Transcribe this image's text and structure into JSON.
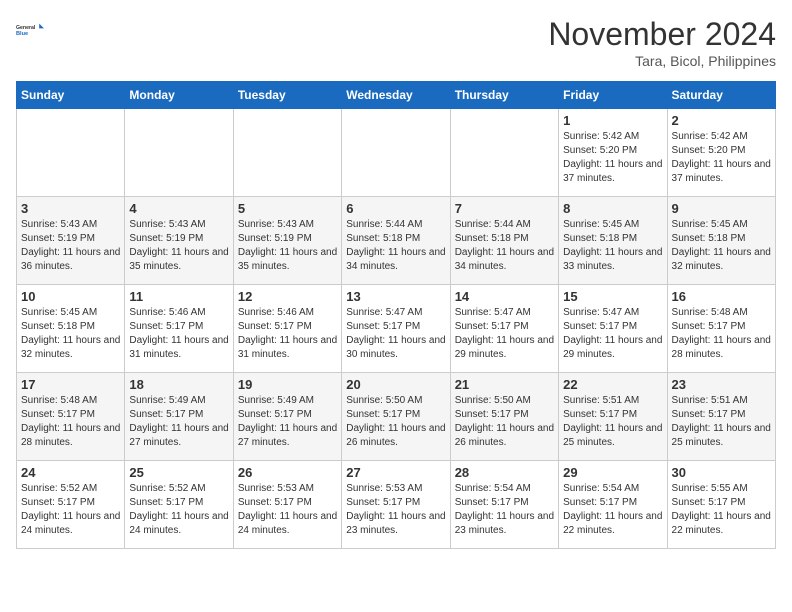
{
  "header": {
    "logo_line1": "General",
    "logo_line2": "Blue",
    "month": "November 2024",
    "location": "Tara, Bicol, Philippines"
  },
  "weekdays": [
    "Sunday",
    "Monday",
    "Tuesday",
    "Wednesday",
    "Thursday",
    "Friday",
    "Saturday"
  ],
  "weeks": [
    [
      {
        "day": "",
        "sunrise": "",
        "sunset": "",
        "daylight": ""
      },
      {
        "day": "",
        "sunrise": "",
        "sunset": "",
        "daylight": ""
      },
      {
        "day": "",
        "sunrise": "",
        "sunset": "",
        "daylight": ""
      },
      {
        "day": "",
        "sunrise": "",
        "sunset": "",
        "daylight": ""
      },
      {
        "day": "",
        "sunrise": "",
        "sunset": "",
        "daylight": ""
      },
      {
        "day": "1",
        "sunrise": "Sunrise: 5:42 AM",
        "sunset": "Sunset: 5:20 PM",
        "daylight": "Daylight: 11 hours and 37 minutes."
      },
      {
        "day": "2",
        "sunrise": "Sunrise: 5:42 AM",
        "sunset": "Sunset: 5:20 PM",
        "daylight": "Daylight: 11 hours and 37 minutes."
      }
    ],
    [
      {
        "day": "3",
        "sunrise": "Sunrise: 5:43 AM",
        "sunset": "Sunset: 5:19 PM",
        "daylight": "Daylight: 11 hours and 36 minutes."
      },
      {
        "day": "4",
        "sunrise": "Sunrise: 5:43 AM",
        "sunset": "Sunset: 5:19 PM",
        "daylight": "Daylight: 11 hours and 35 minutes."
      },
      {
        "day": "5",
        "sunrise": "Sunrise: 5:43 AM",
        "sunset": "Sunset: 5:19 PM",
        "daylight": "Daylight: 11 hours and 35 minutes."
      },
      {
        "day": "6",
        "sunrise": "Sunrise: 5:44 AM",
        "sunset": "Sunset: 5:18 PM",
        "daylight": "Daylight: 11 hours and 34 minutes."
      },
      {
        "day": "7",
        "sunrise": "Sunrise: 5:44 AM",
        "sunset": "Sunset: 5:18 PM",
        "daylight": "Daylight: 11 hours and 34 minutes."
      },
      {
        "day": "8",
        "sunrise": "Sunrise: 5:45 AM",
        "sunset": "Sunset: 5:18 PM",
        "daylight": "Daylight: 11 hours and 33 minutes."
      },
      {
        "day": "9",
        "sunrise": "Sunrise: 5:45 AM",
        "sunset": "Sunset: 5:18 PM",
        "daylight": "Daylight: 11 hours and 32 minutes."
      }
    ],
    [
      {
        "day": "10",
        "sunrise": "Sunrise: 5:45 AM",
        "sunset": "Sunset: 5:18 PM",
        "daylight": "Daylight: 11 hours and 32 minutes."
      },
      {
        "day": "11",
        "sunrise": "Sunrise: 5:46 AM",
        "sunset": "Sunset: 5:17 PM",
        "daylight": "Daylight: 11 hours and 31 minutes."
      },
      {
        "day": "12",
        "sunrise": "Sunrise: 5:46 AM",
        "sunset": "Sunset: 5:17 PM",
        "daylight": "Daylight: 11 hours and 31 minutes."
      },
      {
        "day": "13",
        "sunrise": "Sunrise: 5:47 AM",
        "sunset": "Sunset: 5:17 PM",
        "daylight": "Daylight: 11 hours and 30 minutes."
      },
      {
        "day": "14",
        "sunrise": "Sunrise: 5:47 AM",
        "sunset": "Sunset: 5:17 PM",
        "daylight": "Daylight: 11 hours and 29 minutes."
      },
      {
        "day": "15",
        "sunrise": "Sunrise: 5:47 AM",
        "sunset": "Sunset: 5:17 PM",
        "daylight": "Daylight: 11 hours and 29 minutes."
      },
      {
        "day": "16",
        "sunrise": "Sunrise: 5:48 AM",
        "sunset": "Sunset: 5:17 PM",
        "daylight": "Daylight: 11 hours and 28 minutes."
      }
    ],
    [
      {
        "day": "17",
        "sunrise": "Sunrise: 5:48 AM",
        "sunset": "Sunset: 5:17 PM",
        "daylight": "Daylight: 11 hours and 28 minutes."
      },
      {
        "day": "18",
        "sunrise": "Sunrise: 5:49 AM",
        "sunset": "Sunset: 5:17 PM",
        "daylight": "Daylight: 11 hours and 27 minutes."
      },
      {
        "day": "19",
        "sunrise": "Sunrise: 5:49 AM",
        "sunset": "Sunset: 5:17 PM",
        "daylight": "Daylight: 11 hours and 27 minutes."
      },
      {
        "day": "20",
        "sunrise": "Sunrise: 5:50 AM",
        "sunset": "Sunset: 5:17 PM",
        "daylight": "Daylight: 11 hours and 26 minutes."
      },
      {
        "day": "21",
        "sunrise": "Sunrise: 5:50 AM",
        "sunset": "Sunset: 5:17 PM",
        "daylight": "Daylight: 11 hours and 26 minutes."
      },
      {
        "day": "22",
        "sunrise": "Sunrise: 5:51 AM",
        "sunset": "Sunset: 5:17 PM",
        "daylight": "Daylight: 11 hours and 25 minutes."
      },
      {
        "day": "23",
        "sunrise": "Sunrise: 5:51 AM",
        "sunset": "Sunset: 5:17 PM",
        "daylight": "Daylight: 11 hours and 25 minutes."
      }
    ],
    [
      {
        "day": "24",
        "sunrise": "Sunrise: 5:52 AM",
        "sunset": "Sunset: 5:17 PM",
        "daylight": "Daylight: 11 hours and 24 minutes."
      },
      {
        "day": "25",
        "sunrise": "Sunrise: 5:52 AM",
        "sunset": "Sunset: 5:17 PM",
        "daylight": "Daylight: 11 hours and 24 minutes."
      },
      {
        "day": "26",
        "sunrise": "Sunrise: 5:53 AM",
        "sunset": "Sunset: 5:17 PM",
        "daylight": "Daylight: 11 hours and 24 minutes."
      },
      {
        "day": "27",
        "sunrise": "Sunrise: 5:53 AM",
        "sunset": "Sunset: 5:17 PM",
        "daylight": "Daylight: 11 hours and 23 minutes."
      },
      {
        "day": "28",
        "sunrise": "Sunrise: 5:54 AM",
        "sunset": "Sunset: 5:17 PM",
        "daylight": "Daylight: 11 hours and 23 minutes."
      },
      {
        "day": "29",
        "sunrise": "Sunrise: 5:54 AM",
        "sunset": "Sunset: 5:17 PM",
        "daylight": "Daylight: 11 hours and 22 minutes."
      },
      {
        "day": "30",
        "sunrise": "Sunrise: 5:55 AM",
        "sunset": "Sunset: 5:17 PM",
        "daylight": "Daylight: 11 hours and 22 minutes."
      }
    ]
  ]
}
